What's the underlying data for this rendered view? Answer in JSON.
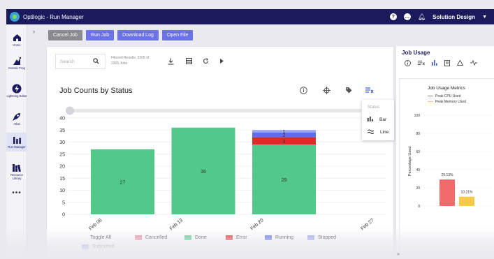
{
  "app": {
    "title": "Optilogic - Run Manager",
    "workspace": "Solution Design"
  },
  "sidebar": {
    "items": [
      {
        "label": "Home",
        "icon": "home-icon"
      },
      {
        "label": "Cosmic Frog",
        "icon": "frog-icon"
      },
      {
        "label": "Lightning Editor",
        "icon": "lightning-icon"
      },
      {
        "label": "Atlas",
        "icon": "rocket-icon"
      },
      {
        "label": "Run Manager",
        "icon": "bar-chart-icon"
      },
      {
        "label": "Resource Library",
        "icon": "library-icon"
      }
    ],
    "more": "•••"
  },
  "toolbar": {
    "cancel_job": "Cancel Job",
    "run_job": "Run Job",
    "download_log": "Download Log",
    "open_file": "Open File"
  },
  "search": {
    "placeholder": "Search"
  },
  "results": {
    "line1": "Filtered Results: 2305 of",
    "line2": "2305 Jobs"
  },
  "chart": {
    "title": "Job Counts by Status"
  },
  "status_menu": {
    "header": "Status",
    "bar": "Bar",
    "line": "Line"
  },
  "chart_data": {
    "type": "bar",
    "stacked": true,
    "title": "Job Counts by Status",
    "categories": [
      "Feb 06",
      "Feb 13",
      "Feb 20",
      "Feb 27"
    ],
    "ylim": [
      0,
      40
    ],
    "yticks": [
      0,
      5,
      10,
      15,
      20,
      25,
      30,
      35,
      40
    ],
    "series": [
      {
        "name": "Done",
        "color": "#52c98a",
        "values": [
          27,
          36,
          29,
          0
        ],
        "labels": [
          "27",
          "36",
          "29",
          ""
        ]
      },
      {
        "name": "Error",
        "color": "#e02a2a",
        "values": [
          0,
          0,
          3,
          0
        ],
        "labels": [
          "",
          "",
          "3",
          ""
        ]
      },
      {
        "name": "Running",
        "color": "#5b6ef0",
        "values": [
          0,
          0,
          2,
          0
        ],
        "labels": [
          "",
          "",
          "2",
          ""
        ]
      },
      {
        "name": "Stopped",
        "color": "#9aa3f3",
        "values": [
          0,
          0,
          1,
          0
        ],
        "labels": [
          "",
          "",
          "1",
          ""
        ]
      }
    ],
    "grid": true
  },
  "legend": {
    "toggle_all": "Toggle All",
    "items": [
      {
        "name": "Cancelled",
        "color": "#f28b9a"
      },
      {
        "name": "Done",
        "color": "#52c98a"
      },
      {
        "name": "Error",
        "color": "#e02a2a"
      },
      {
        "name": "Running",
        "color": "#5b6ef0"
      },
      {
        "name": "Stopped",
        "color": "#9aa3f3"
      },
      {
        "name": "Submitted",
        "color": "#8a8fe0"
      }
    ]
  },
  "job_usage": {
    "title": "Job Usage",
    "chart_title": "Job Usage Metrics",
    "legend_cpu": "Peak CPU Used",
    "legend_mem": "Peak Memory Used",
    "ylabel": "Percentage Used",
    "yticks": [
      0,
      20,
      40,
      60,
      80,
      100
    ],
    "cpu_value": 29.13,
    "mem_value": 10.21,
    "cpu_label": "29.13%",
    "mem_label": "10.21%",
    "cpu_color": "#f26b6b",
    "mem_color": "#f7c948"
  }
}
